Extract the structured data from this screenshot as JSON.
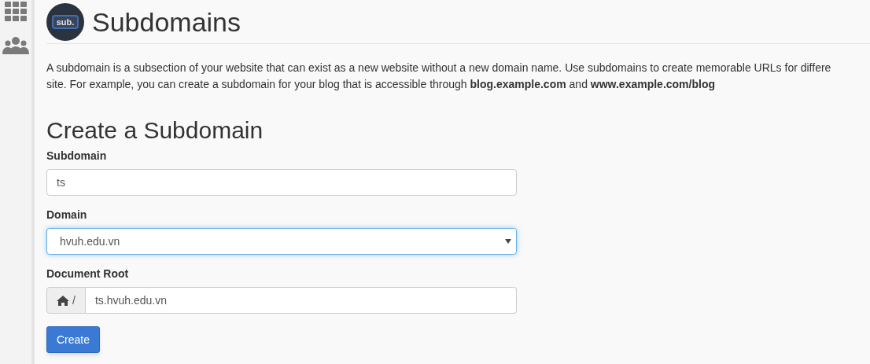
{
  "sidebar": {
    "items": [
      {
        "kind": "grid"
      },
      {
        "kind": "users"
      }
    ]
  },
  "header": {
    "logo_text": "sub.",
    "title": "Subdomains"
  },
  "description": [
    "A subdomain is a subsection of your website that can exist as a new website without a new domain name. Use subdomains to create memorable URLs for differe",
    "site. For example, you can create a subdomain for your blog that is accessible through **blog.example.com** and **www.example.com/blog**"
  ],
  "form": {
    "heading": "Create a Subdomain",
    "fields": [
      {
        "kind": "text",
        "label": "Subdomain",
        "value": "ts",
        "focused": false
      },
      {
        "kind": "select",
        "label": "Domain",
        "value": "hvuh.edu.vn",
        "focused": true
      },
      {
        "kind": "path",
        "label": "Document Root",
        "prefix": "/",
        "value": "ts.hvuh.edu.vn",
        "focused": false
      }
    ],
    "button": "Create"
  }
}
